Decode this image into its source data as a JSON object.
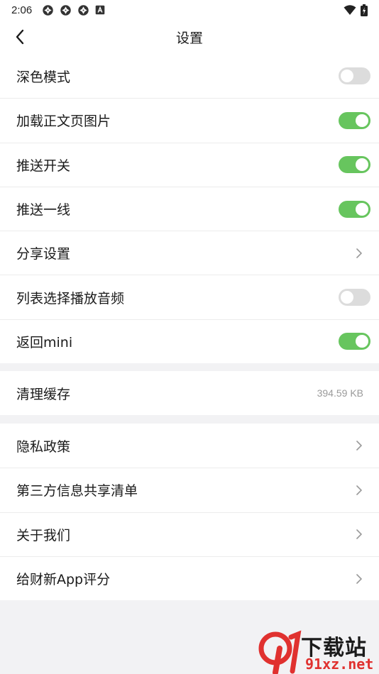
{
  "status_bar": {
    "time": "2:06",
    "notification_icons": [
      "app-notification-icon",
      "app-notification-icon",
      "app-notification-icon",
      "text-a-icon"
    ],
    "right_icons": [
      "wifi-icon",
      "battery-charging-icon"
    ]
  },
  "header": {
    "title": "设置",
    "back_icon": "chevron-left-icon"
  },
  "colors": {
    "toggle_on": "#67c55e",
    "toggle_off": "#dcdcdc",
    "page_background": "#f2f2f4",
    "watermark_red": "#e0312f"
  },
  "settings": {
    "dark_mode": {
      "label": "深色模式",
      "enabled": false
    },
    "load_images": {
      "label": "加载正文页图片",
      "enabled": true
    },
    "push_switch": {
      "label": "推送开关",
      "enabled": true
    },
    "push_frontline": {
      "label": "推送一线",
      "enabled": true
    },
    "share_settings": {
      "label": "分享设置",
      "icon": "chevron-right-icon"
    },
    "list_audio": {
      "label": "列表选择播放音频",
      "enabled": false
    },
    "back_mini": {
      "label": "返回mini",
      "enabled": true
    }
  },
  "cache": {
    "label": "清理缓存",
    "size": "394.59 KB"
  },
  "about": {
    "privacy_policy": {
      "label": "隐私政策",
      "icon": "chevron-right-icon"
    },
    "third_party_list": {
      "label": "第三方信息共享清单",
      "icon": "chevron-right-icon"
    },
    "about_us": {
      "label": "关于我们",
      "icon": "chevron-right-icon"
    },
    "rate_app": {
      "label": "给财新App评分",
      "icon": "chevron-right-icon"
    }
  },
  "watermark": {
    "text": "下载站",
    "url": "91xz.net"
  }
}
